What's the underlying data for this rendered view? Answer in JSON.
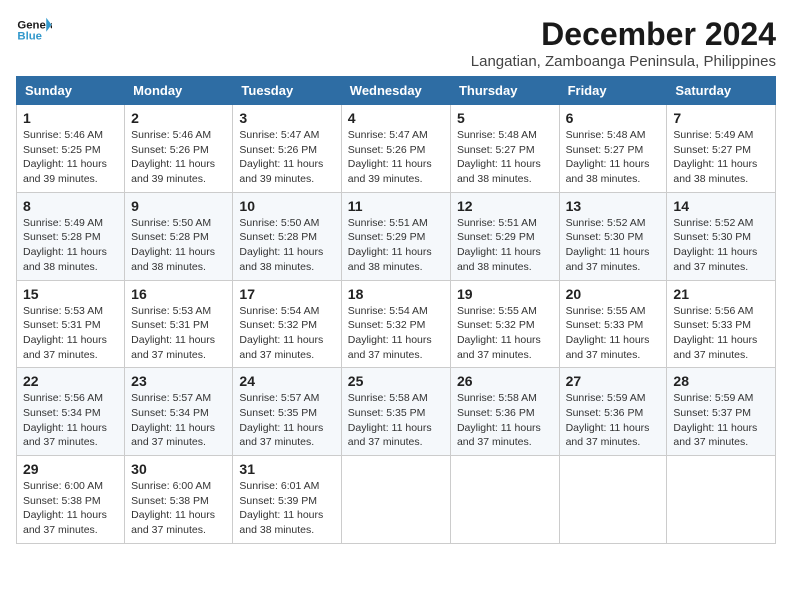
{
  "logo": {
    "line1": "General",
    "line2": "Blue"
  },
  "title": "December 2024",
  "location": "Langatian, Zamboanga Peninsula, Philippines",
  "weekdays": [
    "Sunday",
    "Monday",
    "Tuesday",
    "Wednesday",
    "Thursday",
    "Friday",
    "Saturday"
  ],
  "weeks": [
    [
      {
        "day": "1",
        "info": "Sunrise: 5:46 AM\nSunset: 5:25 PM\nDaylight: 11 hours\nand 39 minutes."
      },
      {
        "day": "2",
        "info": "Sunrise: 5:46 AM\nSunset: 5:26 PM\nDaylight: 11 hours\nand 39 minutes."
      },
      {
        "day": "3",
        "info": "Sunrise: 5:47 AM\nSunset: 5:26 PM\nDaylight: 11 hours\nand 39 minutes."
      },
      {
        "day": "4",
        "info": "Sunrise: 5:47 AM\nSunset: 5:26 PM\nDaylight: 11 hours\nand 39 minutes."
      },
      {
        "day": "5",
        "info": "Sunrise: 5:48 AM\nSunset: 5:27 PM\nDaylight: 11 hours\nand 38 minutes."
      },
      {
        "day": "6",
        "info": "Sunrise: 5:48 AM\nSunset: 5:27 PM\nDaylight: 11 hours\nand 38 minutes."
      },
      {
        "day": "7",
        "info": "Sunrise: 5:49 AM\nSunset: 5:27 PM\nDaylight: 11 hours\nand 38 minutes."
      }
    ],
    [
      {
        "day": "8",
        "info": "Sunrise: 5:49 AM\nSunset: 5:28 PM\nDaylight: 11 hours\nand 38 minutes."
      },
      {
        "day": "9",
        "info": "Sunrise: 5:50 AM\nSunset: 5:28 PM\nDaylight: 11 hours\nand 38 minutes."
      },
      {
        "day": "10",
        "info": "Sunrise: 5:50 AM\nSunset: 5:28 PM\nDaylight: 11 hours\nand 38 minutes."
      },
      {
        "day": "11",
        "info": "Sunrise: 5:51 AM\nSunset: 5:29 PM\nDaylight: 11 hours\nand 38 minutes."
      },
      {
        "day": "12",
        "info": "Sunrise: 5:51 AM\nSunset: 5:29 PM\nDaylight: 11 hours\nand 38 minutes."
      },
      {
        "day": "13",
        "info": "Sunrise: 5:52 AM\nSunset: 5:30 PM\nDaylight: 11 hours\nand 37 minutes."
      },
      {
        "day": "14",
        "info": "Sunrise: 5:52 AM\nSunset: 5:30 PM\nDaylight: 11 hours\nand 37 minutes."
      }
    ],
    [
      {
        "day": "15",
        "info": "Sunrise: 5:53 AM\nSunset: 5:31 PM\nDaylight: 11 hours\nand 37 minutes."
      },
      {
        "day": "16",
        "info": "Sunrise: 5:53 AM\nSunset: 5:31 PM\nDaylight: 11 hours\nand 37 minutes."
      },
      {
        "day": "17",
        "info": "Sunrise: 5:54 AM\nSunset: 5:32 PM\nDaylight: 11 hours\nand 37 minutes."
      },
      {
        "day": "18",
        "info": "Sunrise: 5:54 AM\nSunset: 5:32 PM\nDaylight: 11 hours\nand 37 minutes."
      },
      {
        "day": "19",
        "info": "Sunrise: 5:55 AM\nSunset: 5:32 PM\nDaylight: 11 hours\nand 37 minutes."
      },
      {
        "day": "20",
        "info": "Sunrise: 5:55 AM\nSunset: 5:33 PM\nDaylight: 11 hours\nand 37 minutes."
      },
      {
        "day": "21",
        "info": "Sunrise: 5:56 AM\nSunset: 5:33 PM\nDaylight: 11 hours\nand 37 minutes."
      }
    ],
    [
      {
        "day": "22",
        "info": "Sunrise: 5:56 AM\nSunset: 5:34 PM\nDaylight: 11 hours\nand 37 minutes."
      },
      {
        "day": "23",
        "info": "Sunrise: 5:57 AM\nSunset: 5:34 PM\nDaylight: 11 hours\nand 37 minutes."
      },
      {
        "day": "24",
        "info": "Sunrise: 5:57 AM\nSunset: 5:35 PM\nDaylight: 11 hours\nand 37 minutes."
      },
      {
        "day": "25",
        "info": "Sunrise: 5:58 AM\nSunset: 5:35 PM\nDaylight: 11 hours\nand 37 minutes."
      },
      {
        "day": "26",
        "info": "Sunrise: 5:58 AM\nSunset: 5:36 PM\nDaylight: 11 hours\nand 37 minutes."
      },
      {
        "day": "27",
        "info": "Sunrise: 5:59 AM\nSunset: 5:36 PM\nDaylight: 11 hours\nand 37 minutes."
      },
      {
        "day": "28",
        "info": "Sunrise: 5:59 AM\nSunset: 5:37 PM\nDaylight: 11 hours\nand 37 minutes."
      }
    ],
    [
      {
        "day": "29",
        "info": "Sunrise: 6:00 AM\nSunset: 5:38 PM\nDaylight: 11 hours\nand 37 minutes."
      },
      {
        "day": "30",
        "info": "Sunrise: 6:00 AM\nSunset: 5:38 PM\nDaylight: 11 hours\nand 37 minutes."
      },
      {
        "day": "31",
        "info": "Sunrise: 6:01 AM\nSunset: 5:39 PM\nDaylight: 11 hours\nand 38 minutes."
      },
      null,
      null,
      null,
      null
    ]
  ]
}
